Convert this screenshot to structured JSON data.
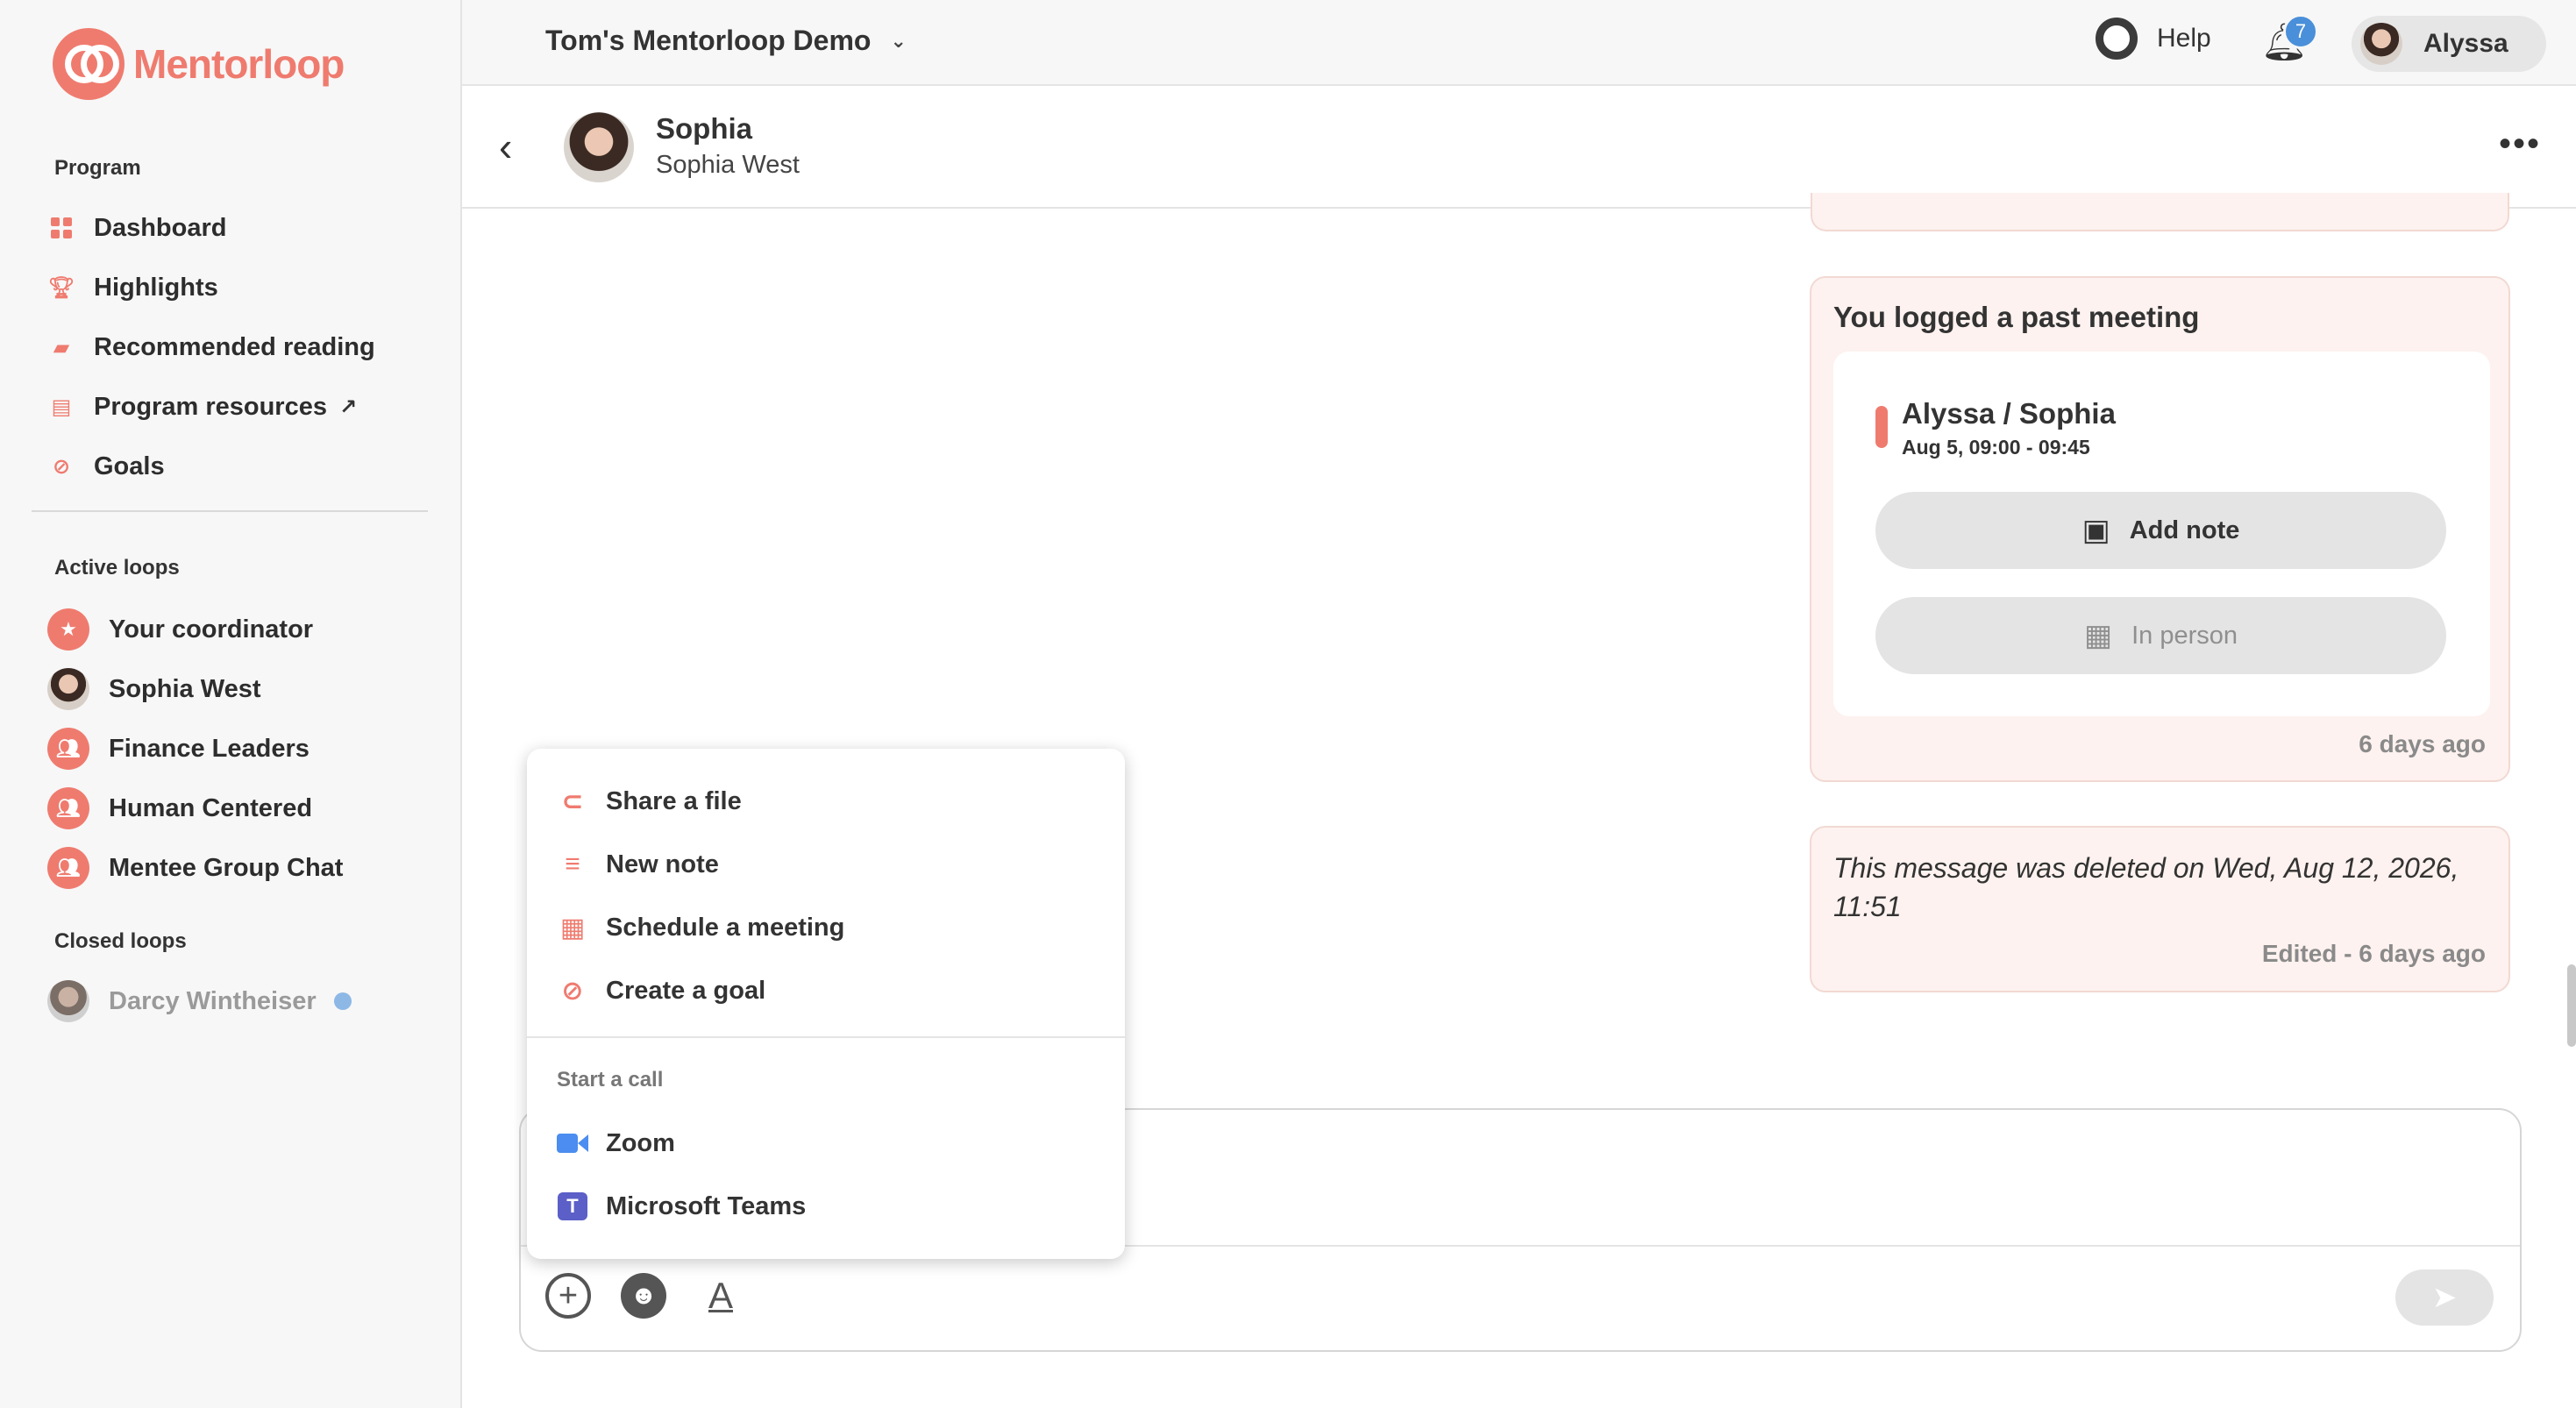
{
  "brand": {
    "name": "Mentorloop",
    "accent": "#ef7b6f"
  },
  "sidebar": {
    "program_label": "Program",
    "program_items": [
      {
        "label": "Dashboard",
        "icon": "dashboard-icon"
      },
      {
        "label": "Highlights",
        "icon": "trophy-icon"
      },
      {
        "label": "Recommended reading",
        "icon": "book-icon"
      },
      {
        "label": "Program resources",
        "icon": "document-icon",
        "external": "↗"
      },
      {
        "label": "Goals",
        "icon": "check-circle-icon"
      }
    ],
    "active_loops_label": "Active loops",
    "active_loops": [
      {
        "label": "Your coordinator",
        "icon": "star-icon"
      },
      {
        "label": "Sophia West",
        "icon": "avatar"
      },
      {
        "label": "Finance Leaders",
        "icon": "group-icon"
      },
      {
        "label": "Human Centered",
        "icon": "group-icon"
      },
      {
        "label": "Mentee Group Chat",
        "icon": "group-icon"
      }
    ],
    "closed_loops_label": "Closed loops",
    "closed_loops": [
      {
        "label": "Darcy Wintheiser",
        "icon": "avatar",
        "unread_dot_color": "#8db8e6"
      }
    ]
  },
  "topbar": {
    "workspace": "Tom's Mentorloop Demo",
    "help_label": "Help",
    "notification_count": "7",
    "user_name": "Alyssa"
  },
  "chat": {
    "title": "Sophia",
    "subtitle": "Sophia West"
  },
  "messages": {
    "meeting": {
      "heading": "You logged a past meeting",
      "title": "Alyssa / Sophia",
      "time": "Aug 5, 09:00 - 09:45",
      "add_note_label": "Add note",
      "location_label": "In person",
      "timestamp": "6 days ago"
    },
    "deleted": {
      "text": "This message was deleted on Wed, Aug 12, 2026, 11:51",
      "timestamp": "Edited - 6 days ago"
    }
  },
  "menu": {
    "items": [
      {
        "label": "Share a file",
        "icon": "paperclip-icon"
      },
      {
        "label": "New note",
        "icon": "note-add-icon"
      },
      {
        "label": "Schedule a meeting",
        "icon": "calendar-icon"
      },
      {
        "label": "Create a goal",
        "icon": "check-circle-icon"
      }
    ],
    "call_section_label": "Start a call",
    "call_items": [
      {
        "label": "Zoom",
        "icon": "zoom-icon",
        "color": "#4b8df0"
      },
      {
        "label": "Microsoft Teams",
        "icon": "teams-icon",
        "color": "#5b5fc7"
      }
    ]
  }
}
